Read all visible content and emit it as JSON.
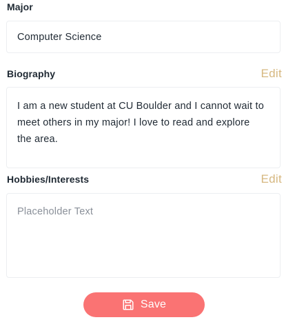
{
  "major": {
    "label": "Major",
    "value": "Computer Science"
  },
  "biography": {
    "label": "Biography",
    "edit_label": "Edit",
    "value": "I am a new student at CU Boulder and I cannot wait to meet others in my major! I love to read and explore the area."
  },
  "hobbies": {
    "label": "Hobbies/Interests",
    "edit_label": "Edit",
    "placeholder": "Placeholder Text"
  },
  "save_button": {
    "label": "Save",
    "icon": "save-icon"
  },
  "colors": {
    "accent_edit": "#d6b77f",
    "save_button_bg": "#fa7373",
    "border": "#eceef1"
  }
}
